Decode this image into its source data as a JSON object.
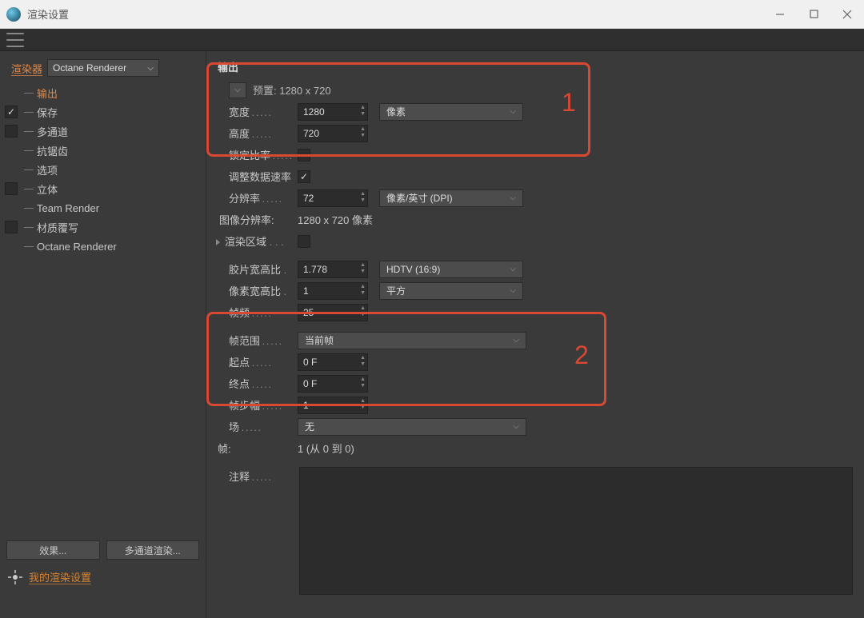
{
  "window": {
    "title": "渲染设置"
  },
  "sidebar": {
    "renderer_label": "渲染器",
    "renderer_value": "Octane Renderer",
    "items": [
      {
        "label": "输出",
        "active": true,
        "check": null
      },
      {
        "label": "保存",
        "check": true
      },
      {
        "label": "多通道",
        "check": false
      },
      {
        "label": "抗锯齿",
        "check": null
      },
      {
        "label": "选项",
        "check": null
      },
      {
        "label": "立体",
        "check": false
      },
      {
        "label": "Team Render",
        "check": null
      },
      {
        "label": "材质覆写",
        "check": false
      },
      {
        "label": "Octane Renderer",
        "check": null
      }
    ],
    "effects_btn": "效果...",
    "multipass_btn": "多通道渲染...",
    "my_settings": "我的渲染设置"
  },
  "output": {
    "heading": "输出",
    "preset_label": "预置: 1280 x 720",
    "width_label": "宽度",
    "width_value": "1280",
    "unit_px": "像素",
    "height_label": "高度",
    "height_value": "720",
    "lock_label": "锁定比率",
    "lock_checked": false,
    "adjust_label": "调整数据速率",
    "adjust_checked": true,
    "res_label": "分辨率",
    "res_value": "72",
    "res_unit": "像素/英寸 (DPI)",
    "imgres_label": "图像分辨率:",
    "imgres_value": "1280 x 720 像素",
    "region_label": "渲染区域",
    "region_checked": false,
    "film_label": "胶片宽高比",
    "film_value": "1.778",
    "film_unit": "HDTV (16:9)",
    "pixel_label": "像素宽高比",
    "pixel_value": "1",
    "pixel_unit": "平方",
    "fps_label": "帧频",
    "fps_value": "25",
    "range_label": "帧范围",
    "range_value": "当前帧",
    "start_label": "起点",
    "start_value": "0 F",
    "end_label": "终点",
    "end_value": "0 F",
    "step_label": "帧步幅",
    "step_value": "1",
    "field_label": "场",
    "field_value": "无",
    "frames_label": "帧:",
    "frames_value": "1 (从 0 到 0)",
    "note_label": "注释"
  },
  "annotations": {
    "n1": "1",
    "n2": "2"
  }
}
